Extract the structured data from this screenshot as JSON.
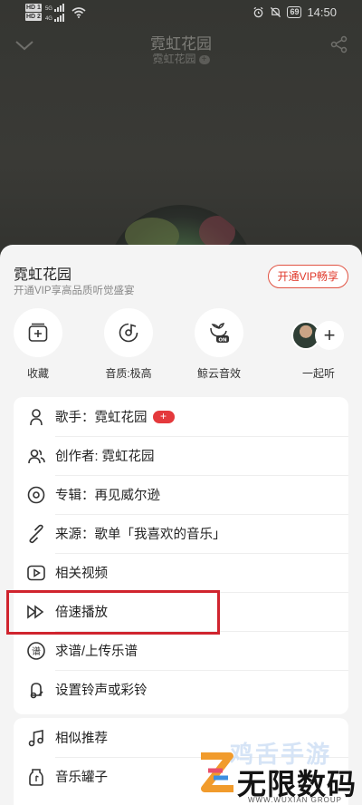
{
  "status_bar": {
    "hd_badges": [
      "HD 1",
      "HD 2"
    ],
    "network_tags": [
      "5G",
      "4G"
    ],
    "battery": "69",
    "time": "14:50"
  },
  "player": {
    "title": "霓虹花园",
    "artist": "霓虹花园",
    "artist_plus": "+"
  },
  "sheet": {
    "title": "霓虹花园",
    "subtitle": "开通VIP享高品质听觉盛宴",
    "vip_button": "开通VIP畅享"
  },
  "quick_actions": [
    {
      "label": "收藏",
      "icon": "add-to-playlist-icon"
    },
    {
      "label": "音质:极高",
      "icon": "audio-quality-icon"
    },
    {
      "label": "鲸云音效",
      "icon": "whale-sound-effect-icon"
    },
    {
      "label": "一起听",
      "icon": "listen-together-icon"
    }
  ],
  "listen_together_plus": "+",
  "menu_main": [
    {
      "label": "歌手：霓虹花园",
      "icon": "singer-icon",
      "badge": "+"
    },
    {
      "label": "创作者: 霓虹花园",
      "icon": "creator-icon"
    },
    {
      "label": "专辑：再见威尔逊",
      "icon": "album-icon"
    },
    {
      "label": "来源：歌单「我喜欢的音乐」",
      "icon": "source-link-icon"
    },
    {
      "label": "相关视频",
      "icon": "video-icon"
    },
    {
      "label": "倍速播放",
      "icon": "speed-play-icon"
    },
    {
      "label": "求谱/上传乐谱",
      "icon": "sheet-music-icon"
    },
    {
      "label": "设置铃声或彩铃",
      "icon": "ringtone-icon"
    }
  ],
  "menu_secondary": [
    {
      "label": "相似推荐",
      "icon": "similar-icon"
    },
    {
      "label": "音乐罐子",
      "icon": "music-jar-icon"
    }
  ],
  "watermark": {
    "top_text": "鸡舌手游",
    "main_text": "无限数码",
    "sub_text": "WWW.WUXIAN GROUP"
  },
  "colors": {
    "accent_red": "#e0392b",
    "highlight": "#d0242e",
    "sheet_bg": "#f4f4f4"
  }
}
